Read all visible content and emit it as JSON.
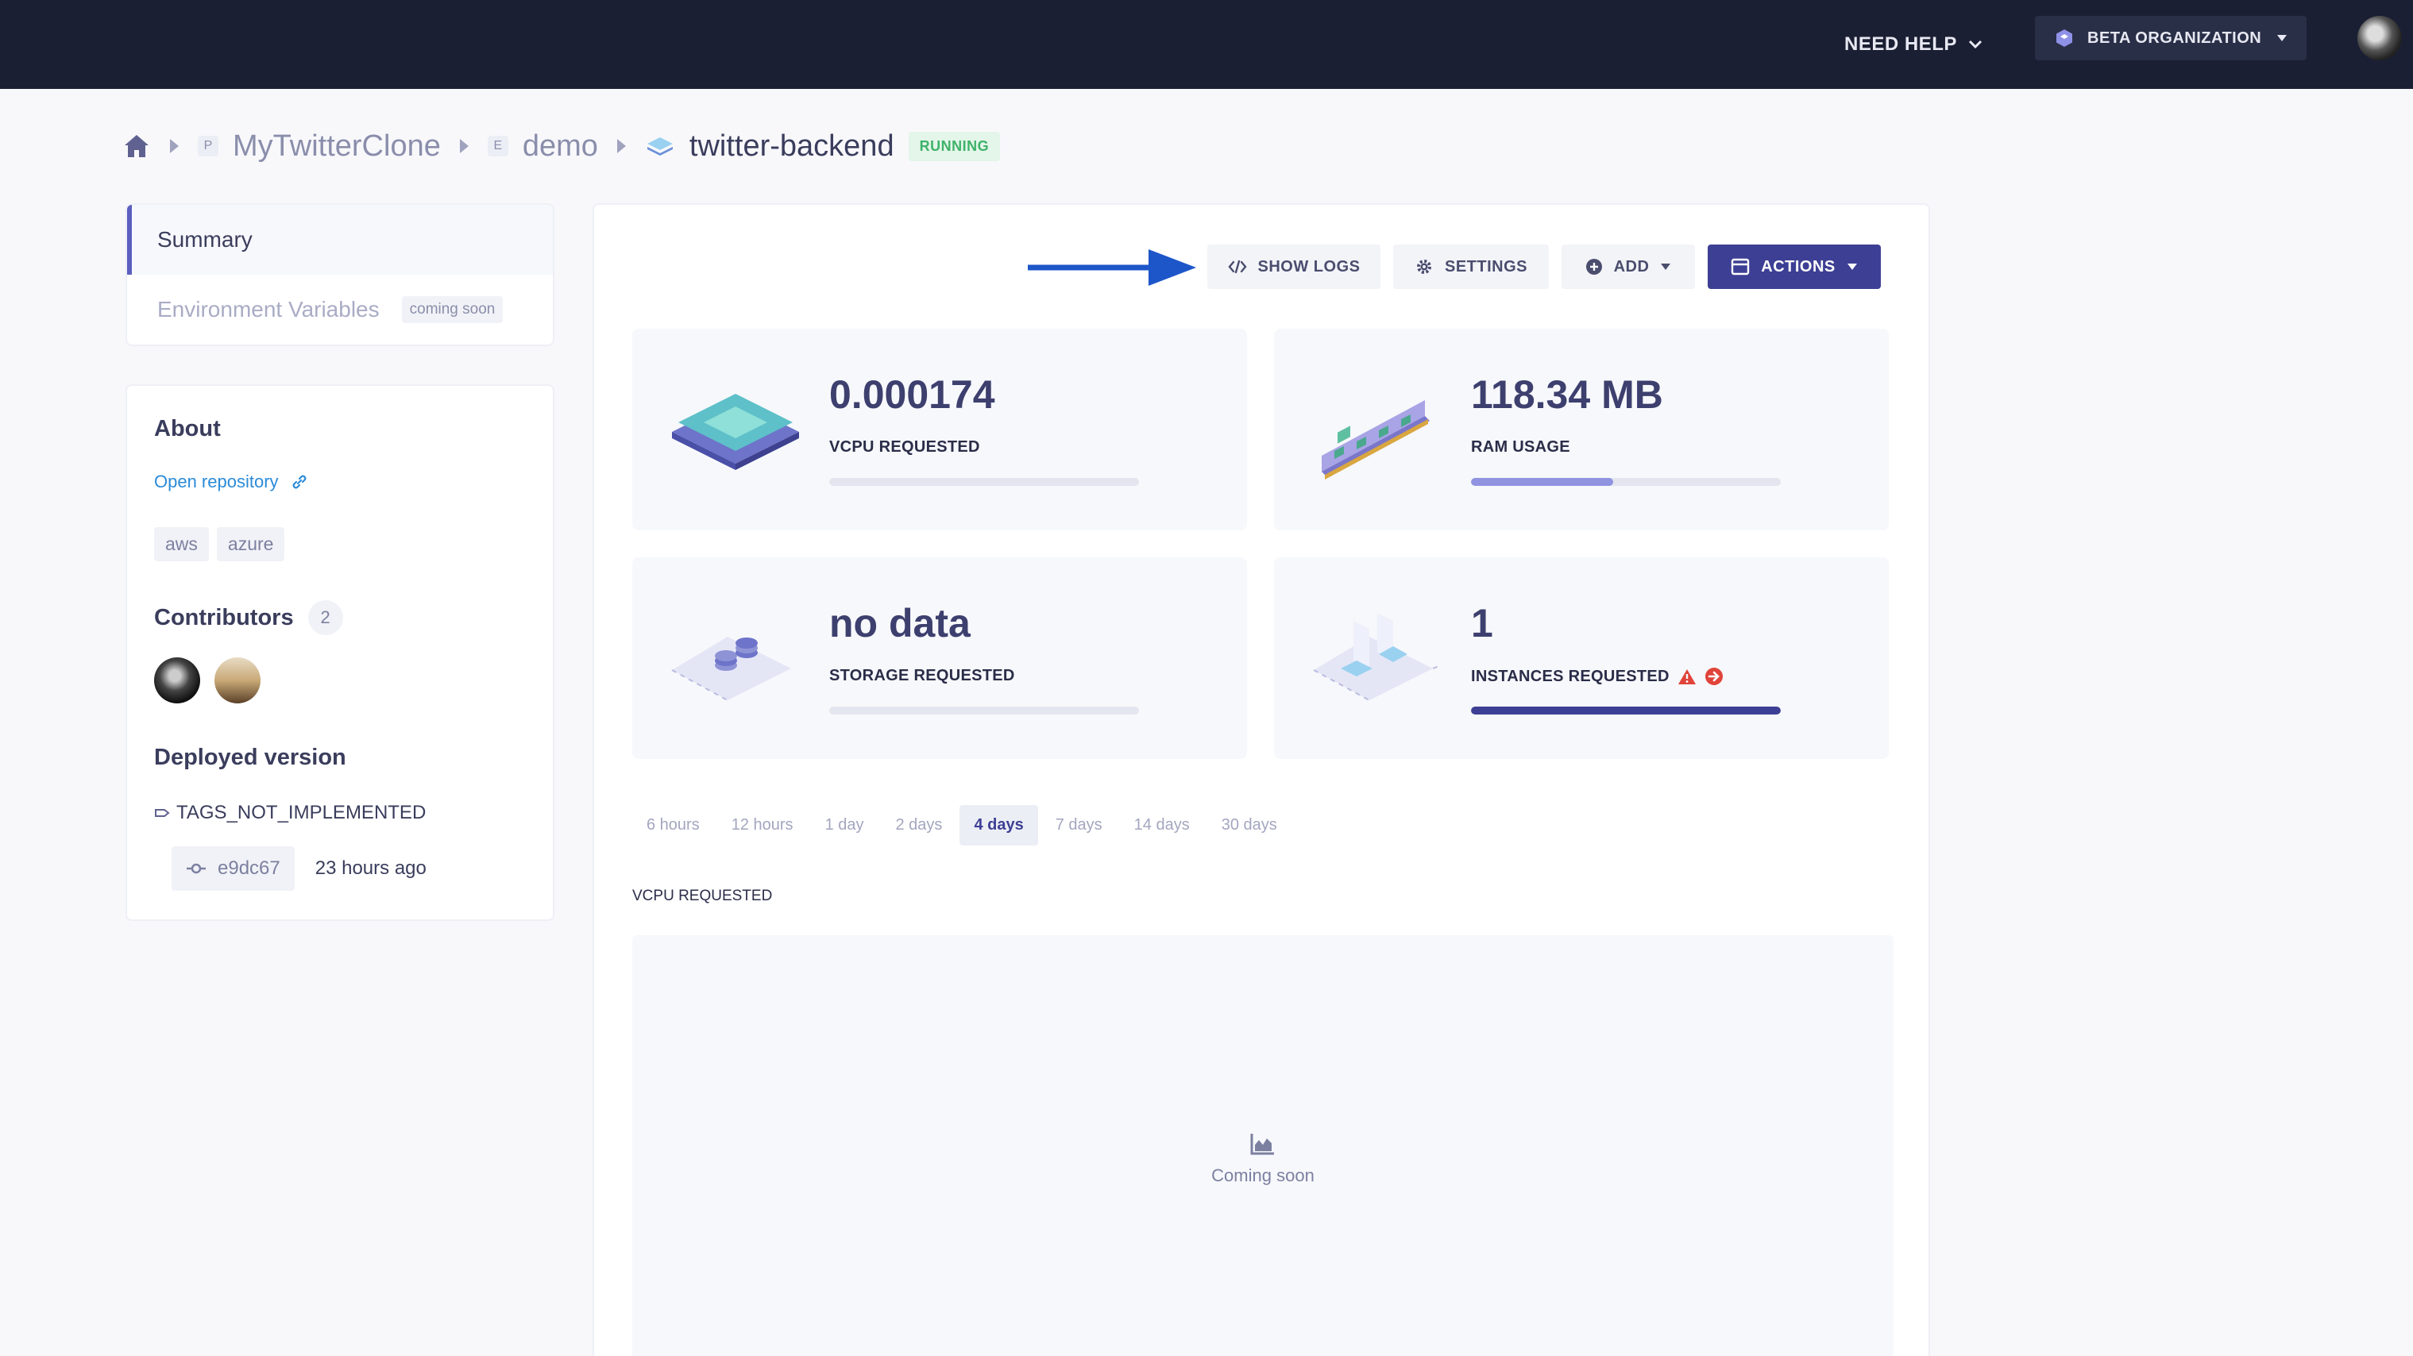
{
  "topbar": {
    "need_help": "NEED HELP",
    "organization": "BETA ORGANIZATION"
  },
  "breadcrumb": {
    "project_letter": "P",
    "project": "MyTwitterClone",
    "env_letter": "E",
    "environment": "demo",
    "app": "twitter-backend",
    "status": "RUNNING"
  },
  "nav": {
    "summary": "Summary",
    "env_vars": "Environment Variables",
    "coming_soon": "coming soon"
  },
  "about": {
    "title": "About",
    "open_repository": "Open repository",
    "tags": [
      "aws",
      "azure"
    ],
    "contributors_label": "Contributors",
    "contributors_count": "2",
    "deployed_label": "Deployed version",
    "tag_name": "TAGS_NOT_IMPLEMENTED",
    "commit": "e9dc67",
    "commit_time": "23 hours ago"
  },
  "toolbar": {
    "show_logs": "SHOW LOGS",
    "settings": "SETTINGS",
    "add": "ADD",
    "actions": "ACTIONS"
  },
  "stats": {
    "vcpu": {
      "value": "0.000174",
      "label": "VCPU REQUESTED",
      "fill_fraction": 0
    },
    "ram": {
      "value": "118.34 MB",
      "label": "RAM USAGE",
      "fill_fraction": 0.46
    },
    "storage": {
      "value": "no data",
      "label": "STORAGE REQUESTED",
      "fill_fraction": 0
    },
    "instances": {
      "value": "1",
      "label": "INSTANCES REQUESTED",
      "fill_fraction": 1
    }
  },
  "ranges": [
    "6 hours",
    "12 hours",
    "1 day",
    "2 days",
    "4 days",
    "7 days",
    "14 days",
    "30 days"
  ],
  "active_range": "4 days",
  "chart": {
    "title": "VCPU REQUESTED",
    "placeholder": "Coming soon"
  },
  "colors": {
    "primary": "#3d3f94",
    "running": "#3fb26a",
    "ram_fill": "#8f93e0",
    "instances_fill": "#3d3f94",
    "warning": "#e0443a",
    "annotation_arrow": "#1d56c9"
  }
}
